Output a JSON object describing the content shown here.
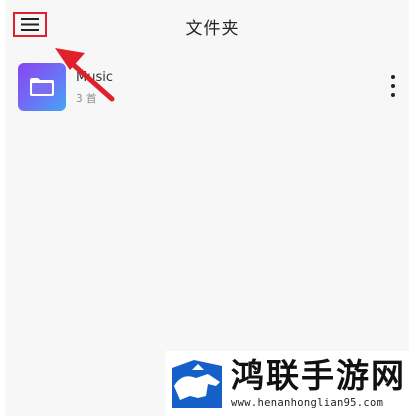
{
  "header": {
    "title": "文件夹",
    "menu_icon": "hamburger-menu-icon"
  },
  "folders": [
    {
      "name": "Music",
      "count": "3 首",
      "icon": "folder-icon"
    }
  ],
  "annotation": {
    "highlight_color": "#e0212c",
    "arrow_icon": "red-arrow-icon"
  },
  "watermark": {
    "brand": "鸿联手游网",
    "url": "www.henanhonglian95.com"
  },
  "colors": {
    "folder_gradient_start": "#8a44f2",
    "folder_gradient_end": "#43a6f7",
    "logo_blue": "#1560c8"
  }
}
